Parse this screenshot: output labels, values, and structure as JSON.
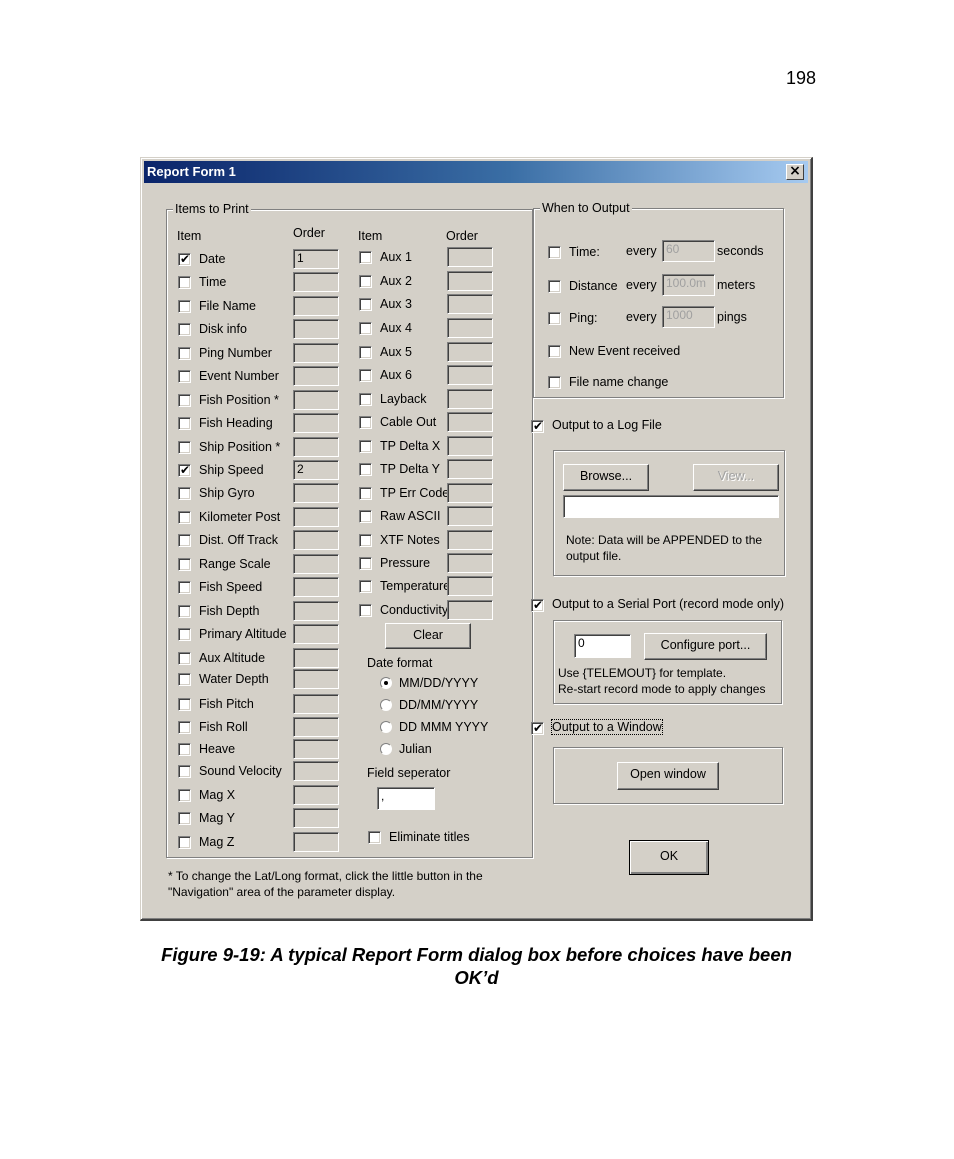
{
  "page": {
    "number": "198",
    "caption": "Figure 9-19: A typical Report Form dialog box before choices have been OK’d"
  },
  "dialog": {
    "title": "Report Form 1",
    "close_label": "×"
  },
  "items_to_print": {
    "legend": "Items to Print",
    "col_item": "Item",
    "col_order": "Order",
    "left_items": [
      {
        "label": "Date",
        "checked": true,
        "order": "1"
      },
      {
        "label": "Time",
        "checked": false,
        "order": ""
      },
      {
        "label": "File Name",
        "checked": false,
        "order": ""
      },
      {
        "label": "Disk info",
        "checked": false,
        "order": ""
      },
      {
        "label": "Ping Number",
        "checked": false,
        "order": ""
      },
      {
        "label": "Event Number",
        "checked": false,
        "order": ""
      },
      {
        "label": "Fish Position *",
        "checked": false,
        "order": ""
      },
      {
        "label": "Fish Heading",
        "checked": false,
        "order": ""
      },
      {
        "label": "Ship Position *",
        "checked": false,
        "order": ""
      },
      {
        "label": "Ship Speed",
        "checked": true,
        "order": "2"
      },
      {
        "label": "Ship Gyro",
        "checked": false,
        "order": ""
      },
      {
        "label": "Kilometer Post",
        "checked": false,
        "order": ""
      },
      {
        "label": "Dist. Off Track",
        "checked": false,
        "order": ""
      },
      {
        "label": "Range Scale",
        "checked": false,
        "order": ""
      },
      {
        "label": "Fish Speed",
        "checked": false,
        "order": ""
      },
      {
        "label": "Fish Depth",
        "checked": false,
        "order": ""
      },
      {
        "label": "Primary Altitude",
        "checked": false,
        "order": ""
      },
      {
        "label": "Aux Altitude",
        "checked": false,
        "order": ""
      },
      {
        "label": "Water Depth",
        "checked": false,
        "order": ""
      },
      {
        "label": "Fish Pitch",
        "checked": false,
        "order": ""
      },
      {
        "label": "Fish Roll",
        "checked": false,
        "order": ""
      },
      {
        "label": "Heave",
        "checked": false,
        "order": ""
      },
      {
        "label": "Sound Velocity",
        "checked": false,
        "order": ""
      },
      {
        "label": "Mag X",
        "checked": false,
        "order": ""
      },
      {
        "label": "Mag Y",
        "checked": false,
        "order": ""
      },
      {
        "label": "Mag Z",
        "checked": false,
        "order": ""
      }
    ],
    "right_items": [
      {
        "label": "Aux 1",
        "checked": false,
        "order": ""
      },
      {
        "label": "Aux 2",
        "checked": false,
        "order": ""
      },
      {
        "label": "Aux 3",
        "checked": false,
        "order": ""
      },
      {
        "label": "Aux 4",
        "checked": false,
        "order": ""
      },
      {
        "label": "Aux 5",
        "checked": false,
        "order": ""
      },
      {
        "label": "Aux 6",
        "checked": false,
        "order": ""
      },
      {
        "label": "Layback",
        "checked": false,
        "order": ""
      },
      {
        "label": "Cable Out",
        "checked": false,
        "order": ""
      },
      {
        "label": "TP Delta X",
        "checked": false,
        "order": ""
      },
      {
        "label": "TP Delta Y",
        "checked": false,
        "order": ""
      },
      {
        "label": "TP Err Code",
        "checked": false,
        "order": ""
      },
      {
        "label": "Raw ASCII",
        "checked": false,
        "order": ""
      },
      {
        "label": "XTF Notes",
        "checked": false,
        "order": ""
      },
      {
        "label": "Pressure",
        "checked": false,
        "order": ""
      },
      {
        "label": "Temperature",
        "checked": false,
        "order": ""
      },
      {
        "label": "Conductivity",
        "checked": false,
        "order": ""
      }
    ],
    "clear_label": "Clear",
    "date_format_label": "Date format",
    "date_formats": [
      {
        "label": "MM/DD/YYYY",
        "selected": true
      },
      {
        "label": "DD/MM/YYYY",
        "selected": false
      },
      {
        "label": "DD MMM YYYY",
        "selected": false
      },
      {
        "label": "Julian",
        "selected": false
      }
    ],
    "field_separator_label": "Field seperator",
    "field_separator_value": ",",
    "eliminate_titles_label": "Eliminate titles",
    "eliminate_titles_checked": false
  },
  "footnote": {
    "line1": "* To change the Lat/Long format, click the little button in the",
    "line2": "\"Navigation\" area of the parameter display."
  },
  "when_to_output": {
    "legend": "When to Output",
    "rows": [
      {
        "label": "Time:",
        "checked": false,
        "every": "every",
        "value": "60",
        "unit": "seconds"
      },
      {
        "label": "Distance",
        "checked": false,
        "every": "every",
        "value": "100.0m",
        "unit": "meters"
      },
      {
        "label": "Ping:",
        "checked": false,
        "every": "every",
        "value": "1000",
        "unit": "pings"
      }
    ],
    "new_event_label": "New Event received",
    "new_event_checked": false,
    "file_name_change_label": "File name change",
    "file_name_change_checked": false
  },
  "log_file": {
    "label": "Output to a Log File",
    "checked": true,
    "browse_label": "Browse...",
    "view_label": "View...",
    "path_value": "",
    "note": "Note: Data will be APPENDED to the output file."
  },
  "serial_port": {
    "label": "Output to a Serial Port (record mode only)",
    "checked": true,
    "port_value": "0",
    "configure_label": "Configure port...",
    "info_line1": "Use {TELEMOUT} for template.",
    "info_line2": "Re-start record mode to apply changes"
  },
  "window_output": {
    "label": "Output to a Window",
    "checked": true,
    "open_label": "Open window"
  },
  "ok_label": "OK"
}
